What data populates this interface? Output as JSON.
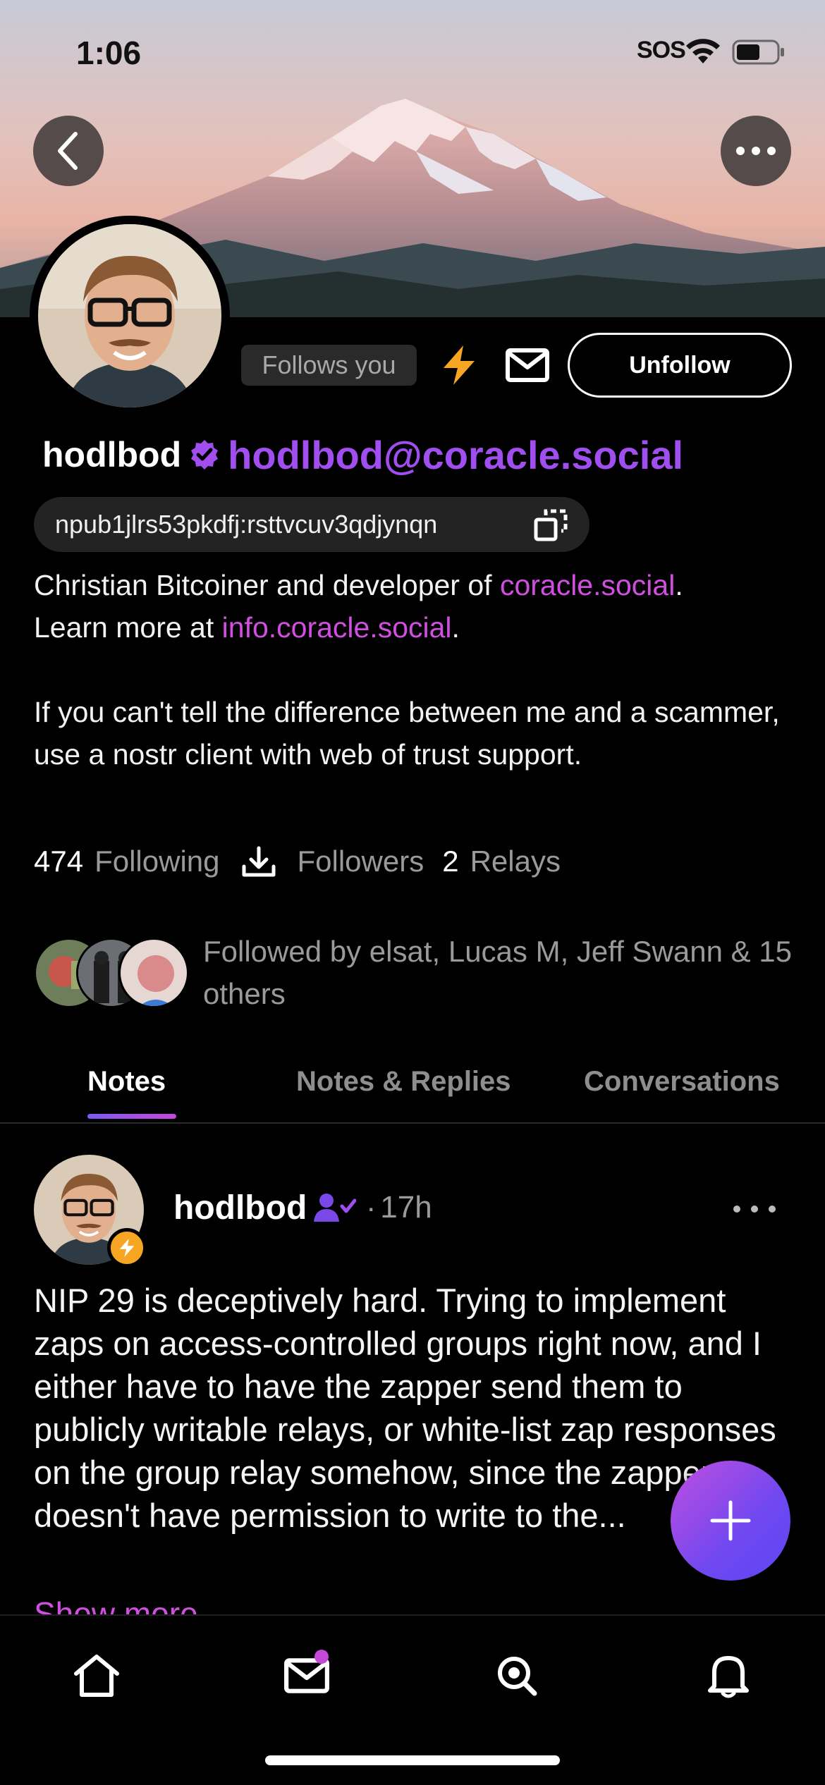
{
  "status_bar": {
    "time": "1:06",
    "sos": "SOS"
  },
  "profile": {
    "follows_you": "Follows you",
    "unfollow_label": "Unfollow",
    "display_name": "hodlbod",
    "nip05": "hodlbod@coracle.social",
    "npub": "npub1jlrs53pkdfj:rsttvcuv3qdjynqn",
    "bio": {
      "line1_text": "Christian Bitcoiner and developer of ",
      "line1_link": "coracle.social",
      "line1_end": ".",
      "line2_text": "Learn more at ",
      "line2_link": "info.coracle.social",
      "line2_end": ".",
      "paragraph2": "If you can't tell the difference between me and a scammer, use a nostr client with web of trust support."
    },
    "stats": {
      "following_count": "474",
      "following_label": "Following",
      "followers_label": "Followers",
      "relays_count": "2",
      "relays_label": "Relays"
    },
    "followed_by": "Followed by elsat, Lucas M, Jeff Swann & 15 others"
  },
  "tabs": [
    {
      "label": "Notes",
      "active": true
    },
    {
      "label": "Notes & Replies",
      "active": false
    },
    {
      "label": "Conversations",
      "active": false
    }
  ],
  "note": {
    "author": "hodlbod",
    "dot": "·",
    "time": "17h",
    "body": "NIP 29 is deceptively hard. Trying to implement zaps on access-controlled groups right now, and I either have to have the zapper send them to publicly writable relays, or white-list zap responses on the group relay somehow, since the zapper doesn't have permission to write to the...",
    "show_more": "Show more"
  },
  "colors": {
    "accent_purple": "#a04ef0",
    "link_pink": "#d04ee0",
    "zap_orange": "#f6a623"
  },
  "icons": [
    "back-icon",
    "more-icon",
    "zap-icon",
    "mail-icon",
    "verified-icon",
    "copy-icon",
    "download-icon",
    "follow-check-icon",
    "plus-icon",
    "home-icon",
    "search-icon",
    "bell-icon"
  ]
}
